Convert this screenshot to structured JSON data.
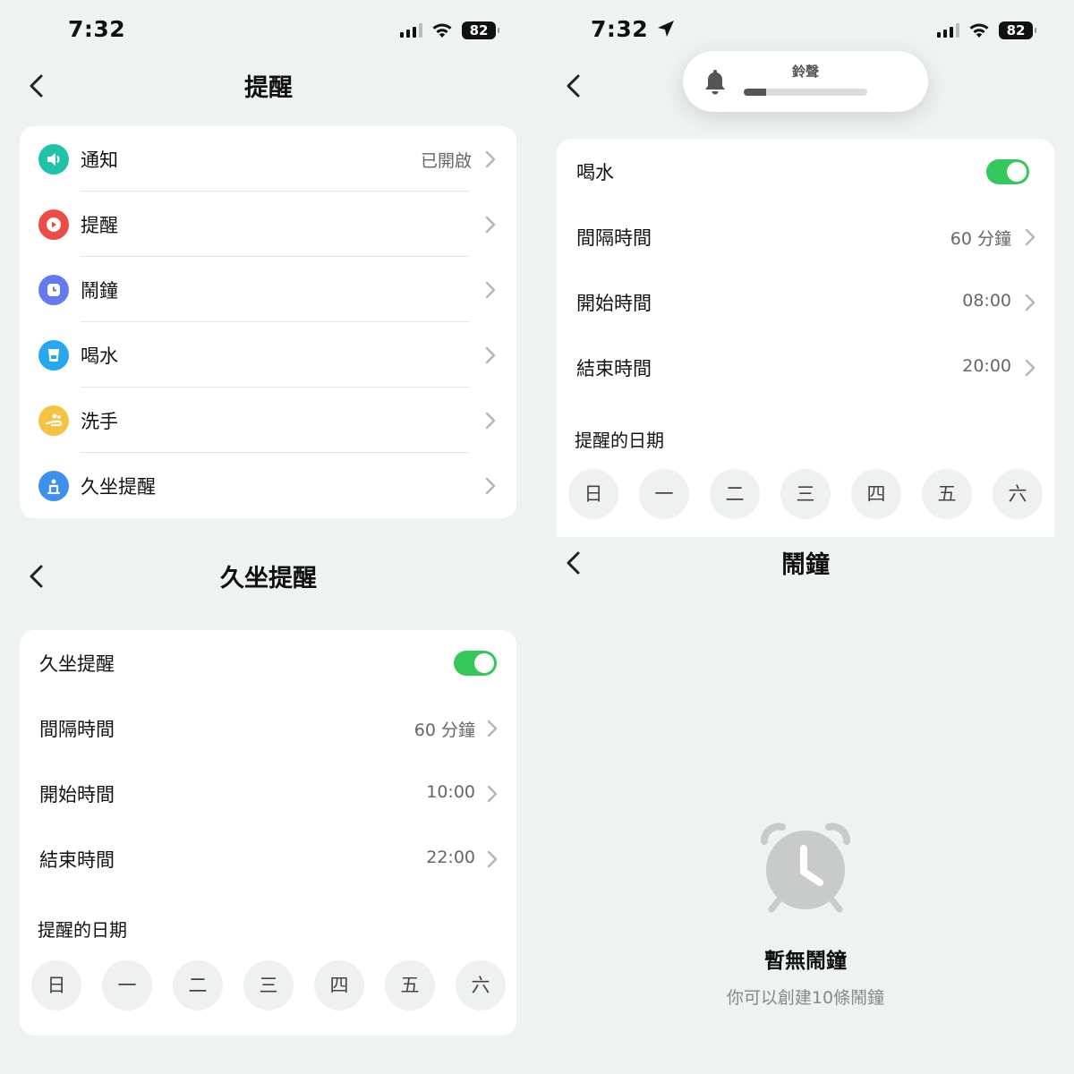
{
  "status": {
    "time": "7:32",
    "battery": "82"
  },
  "reminders_screen": {
    "title": "提醒",
    "items": [
      {
        "label": "通知",
        "value": "已開啟",
        "icon": "speaker-icon",
        "color": "#1fc4a8"
      },
      {
        "label": "提醒",
        "value": "",
        "icon": "play-icon",
        "color": "#ef4b46"
      },
      {
        "label": "鬧鐘",
        "value": "",
        "icon": "alarm-icon",
        "color": "#6579f2"
      },
      {
        "label": "喝水",
        "value": "",
        "icon": "cup-icon",
        "color": "#27a7ef"
      },
      {
        "label": "洗手",
        "value": "",
        "icon": "hand-icon",
        "color": "#f5c242"
      },
      {
        "label": "久坐提醒",
        "value": "",
        "icon": "sitting-icon",
        "color": "#3d8ff0"
      }
    ]
  },
  "water_screen": {
    "ringer_label": "鈴聲",
    "ringer_level": 0.18,
    "toggle_label": "喝水",
    "toggle_on": true,
    "rows": [
      {
        "label": "間隔時間",
        "value": "60 分鐘"
      },
      {
        "label": "開始時間",
        "value": "08:00"
      },
      {
        "label": "結束時間",
        "value": "20:00"
      }
    ],
    "days_title": "提醒的日期",
    "days": [
      "日",
      "一",
      "二",
      "三",
      "四",
      "五",
      "六"
    ]
  },
  "sitting_screen": {
    "title": "久坐提醒",
    "toggle_label": "久坐提醒",
    "toggle_on": true,
    "rows": [
      {
        "label": "間隔時間",
        "value": "60 分鐘"
      },
      {
        "label": "開始時間",
        "value": "10:00"
      },
      {
        "label": "結束時間",
        "value": "22:00"
      }
    ],
    "days_title": "提醒的日期",
    "days": [
      "日",
      "一",
      "二",
      "三",
      "四",
      "五",
      "六"
    ]
  },
  "alarm_screen": {
    "title": "鬧鐘",
    "empty_title": "暫無鬧鐘",
    "empty_subtitle": "你可以創建10條鬧鐘"
  },
  "colors": {
    "accent_toggle": "#34c759",
    "background": "#eef2f0"
  }
}
